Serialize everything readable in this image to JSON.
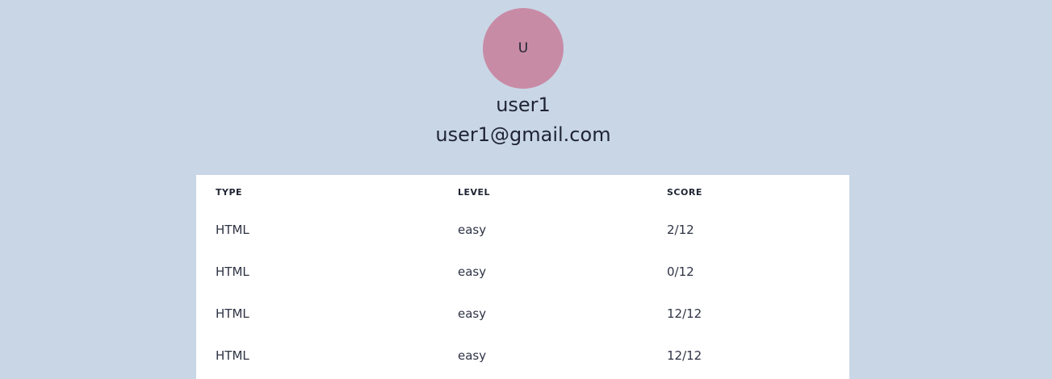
{
  "profile": {
    "avatar_initial": "U",
    "username": "user1",
    "email": "user1@gmail.com"
  },
  "table": {
    "headers": [
      "TYPE",
      "LEVEL",
      "SCORE"
    ],
    "rows": [
      {
        "type": "HTML",
        "level": "easy",
        "score": "2/12"
      },
      {
        "type": "HTML",
        "level": "easy",
        "score": "0/12"
      },
      {
        "type": "HTML",
        "level": "easy",
        "score": "12/12"
      },
      {
        "type": "HTML",
        "level": "easy",
        "score": "12/12"
      }
    ]
  },
  "colors": {
    "background": "#c9d6e6",
    "avatar": "#c88ba5",
    "card": "#ffffff",
    "text": "#1f2433"
  }
}
